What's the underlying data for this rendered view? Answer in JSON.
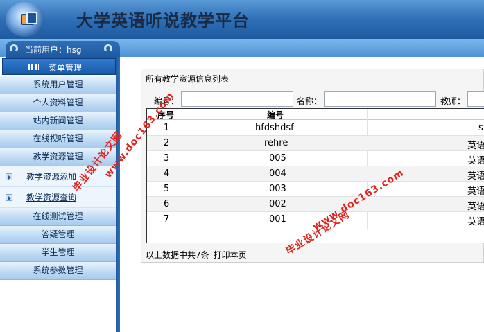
{
  "header": {
    "app_title": "大学英语听说教学平台",
    "current_user": "当前用户：hsg"
  },
  "menu": {
    "header_label": "菜单管理",
    "items": [
      {
        "label": "系统用户管理",
        "type": "section"
      },
      {
        "label": "个人资料管理",
        "type": "section"
      },
      {
        "label": "站内新闻管理",
        "type": "section"
      },
      {
        "label": "在线视听管理",
        "type": "section"
      },
      {
        "label": "教学资源管理",
        "type": "section"
      },
      {
        "label": "教学资源添加",
        "type": "sub"
      },
      {
        "label": "教学资源查询",
        "type": "sub"
      },
      {
        "label": "在线测试管理",
        "type": "section"
      },
      {
        "label": "答疑管理",
        "type": "section"
      },
      {
        "label": "学生管理",
        "type": "section"
      },
      {
        "label": "系统参数管理",
        "type": "section"
      }
    ]
  },
  "panel": {
    "title": "所有教学资源信息列表",
    "search": {
      "code_label": "编号：",
      "name_label": "名称：",
      "teacher_label": "教师："
    },
    "columns": [
      "序号",
      "编号"
    ],
    "rows": [
      {
        "seq": "1",
        "code": "hfdshdsf",
        "extra": "s"
      },
      {
        "seq": "2",
        "code": "rehre",
        "extra": "英语"
      },
      {
        "seq": "3",
        "code": "005",
        "extra": "英语"
      },
      {
        "seq": "4",
        "code": "004",
        "extra": "英语"
      },
      {
        "seq": "5",
        "code": "003",
        "extra": "英语"
      },
      {
        "seq": "6",
        "code": "002",
        "extra": "英语"
      },
      {
        "seq": "7",
        "code": "001",
        "extra": "英语"
      }
    ],
    "footer_text": "以上数据中共7条",
    "print_link": "打印本页"
  },
  "watermark": {
    "line_cn": "毕业设计论文网",
    "line_url": "www.doc163.com"
  }
}
